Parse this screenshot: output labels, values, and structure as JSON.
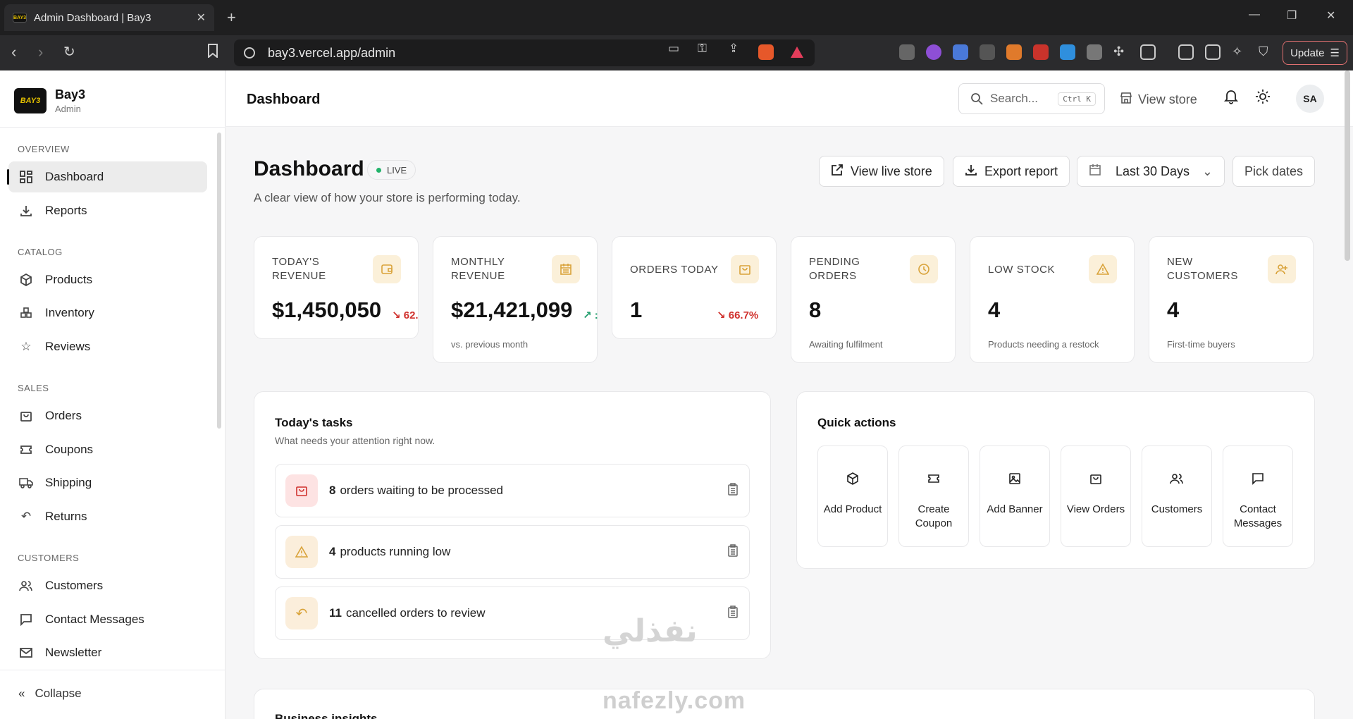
{
  "browser": {
    "tab_title": "Admin Dashboard | Bay3",
    "favicon_text": "BAY3",
    "url": "bay3.vercel.app/admin",
    "update_label": "Update"
  },
  "sidebar": {
    "brand_name": "Bay3",
    "brand_sub": "Admin",
    "logo_text": "BAY3",
    "sections": {
      "overview": "OVERVIEW",
      "catalog": "CATALOG",
      "sales": "SALES",
      "customers": "CUSTOMERS"
    },
    "items": {
      "dashboard": "Dashboard",
      "reports": "Reports",
      "products": "Products",
      "inventory": "Inventory",
      "reviews": "Reviews",
      "orders": "Orders",
      "coupons": "Coupons",
      "shipping": "Shipping",
      "returns": "Returns",
      "customers": "Customers",
      "contact_messages": "Contact Messages",
      "newsletter": "Newsletter"
    },
    "collapse_label": "Collapse"
  },
  "header": {
    "title": "Dashboard",
    "search_placeholder": "Search...",
    "search_shortcut": "Ctrl K",
    "view_store": "View store",
    "avatar_initials": "SA"
  },
  "page": {
    "title": "Dashboard",
    "live_badge": "LIVE",
    "subtitle": "A clear view of how your store is performing today.",
    "view_live_store": "View live store",
    "export_report": "Export report",
    "date_range": "Last 30 Days",
    "pick_dates": "Pick dates"
  },
  "stats": [
    {
      "label": "TODAY'S REVENUE",
      "value": "$1,450,050",
      "change": "↘ 62.",
      "direction": "down",
      "note": ""
    },
    {
      "label": "MONTHLY REVENUE",
      "value": "$21,421,099",
      "change": "↗ :",
      "direction": "up",
      "note": "vs. previous month"
    },
    {
      "label": "ORDERS TODAY",
      "value": "1",
      "change": "↘ 66.7%",
      "direction": "down",
      "note": ""
    },
    {
      "label": "PENDING ORDERS",
      "value": "8",
      "change": "",
      "direction": "",
      "note": "Awaiting fulfilment"
    },
    {
      "label": "LOW STOCK",
      "value": "4",
      "change": "",
      "direction": "",
      "note": "Products needing a restock"
    },
    {
      "label": "NEW CUSTOMERS",
      "value": "4",
      "change": "",
      "direction": "",
      "note": "First-time buyers"
    }
  ],
  "tasks": {
    "title": "Today's tasks",
    "subtitle": "What needs your attention right now.",
    "items": [
      {
        "count": "8",
        "text": "orders waiting to be processed",
        "icon": "bag-icon",
        "color": "#fde3e3"
      },
      {
        "count": "4",
        "text": "products running low",
        "icon": "warning-icon",
        "color": "#fbeedb"
      },
      {
        "count": "11",
        "text": "cancelled orders to review",
        "icon": "undo-icon",
        "color": "#fbeedb"
      }
    ]
  },
  "quick_actions": {
    "title": "Quick actions",
    "items": [
      {
        "label": "Add Product",
        "icon": "package-icon"
      },
      {
        "label": "Create Coupon",
        "icon": "ticket-icon"
      },
      {
        "label": "Add Banner",
        "icon": "image-icon"
      },
      {
        "label": "View Orders",
        "icon": "bag-icon"
      },
      {
        "label": "Customers",
        "icon": "users-icon"
      },
      {
        "label": "Contact Messages",
        "icon": "message-icon"
      }
    ]
  },
  "insights_title": "Business insights",
  "watermark": {
    "arabic": "نفذلي",
    "latin": "nafezly.com"
  },
  "colors": {
    "accent": "#111111",
    "warning_bg": "#fbf0d9",
    "warning_fg": "#d9a33a",
    "down": "#d0312d",
    "up": "#1f9d6b",
    "live": "#22b36a"
  }
}
